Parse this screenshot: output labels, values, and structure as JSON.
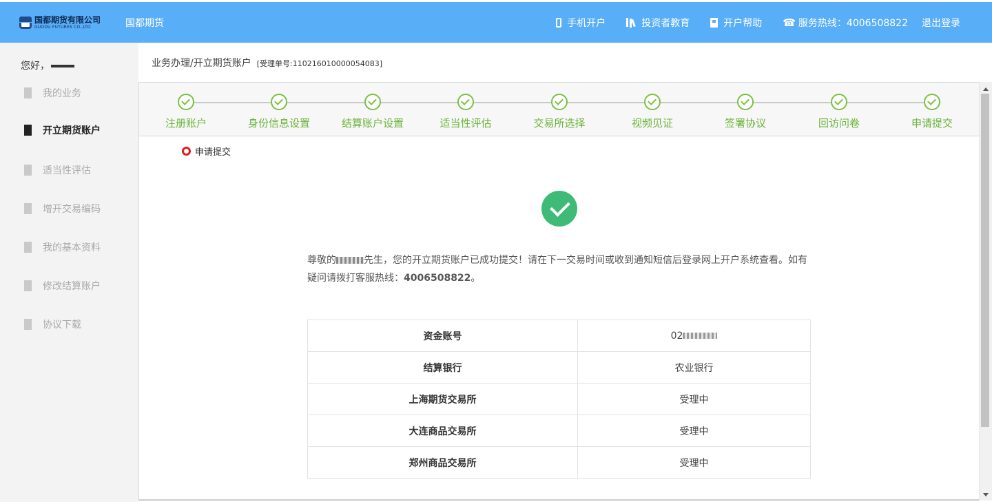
{
  "header": {
    "logo_cn": "国都期货有限公司",
    "logo_en": "GUODU FUTURES CO.,LTD",
    "brand": "国都期货",
    "nav": {
      "mobile": "手机开户",
      "education": "投资者教育",
      "help": "开户帮助",
      "hotline": "服务热线：4006508822",
      "logout": "退出登录"
    }
  },
  "sidebar": {
    "greeting": "您好，",
    "items": [
      {
        "label": "我的业务"
      },
      {
        "label": "开立期货账户"
      },
      {
        "label": "适当性评估"
      },
      {
        "label": "增开交易编码"
      },
      {
        "label": "我的基本资料"
      },
      {
        "label": "修改结算账户"
      },
      {
        "label": "协议下载"
      }
    ]
  },
  "breadcrumb": {
    "path": "业务办理/开立期货账户",
    "order": "[受理单号:110216010000054083]"
  },
  "steps": [
    "注册账户",
    "身份信息设置",
    "结算账户设置",
    "适当性评估",
    "交易所选择",
    "视频见证",
    "签署协议",
    "回访问卷",
    "申请提交"
  ],
  "current_step": "申请提交",
  "message": {
    "prefix": "尊敬的",
    "suffix": "先生，您的开立期货账户已成功提交！请在下一交易时间或收到通知短信后登录网上开户系统查看。如有疑问请拨打客服热线：",
    "phone": "4006508822",
    "end": "。"
  },
  "info_table": [
    {
      "key": "资金账号",
      "value": "02"
    },
    {
      "key": "结算银行",
      "value": "农业银行"
    },
    {
      "key": "上海期货交易所",
      "value": "受理中"
    },
    {
      "key": "大连商品交易所",
      "value": "受理中"
    },
    {
      "key": "郑州商品交易所",
      "value": "受理中"
    }
  ]
}
